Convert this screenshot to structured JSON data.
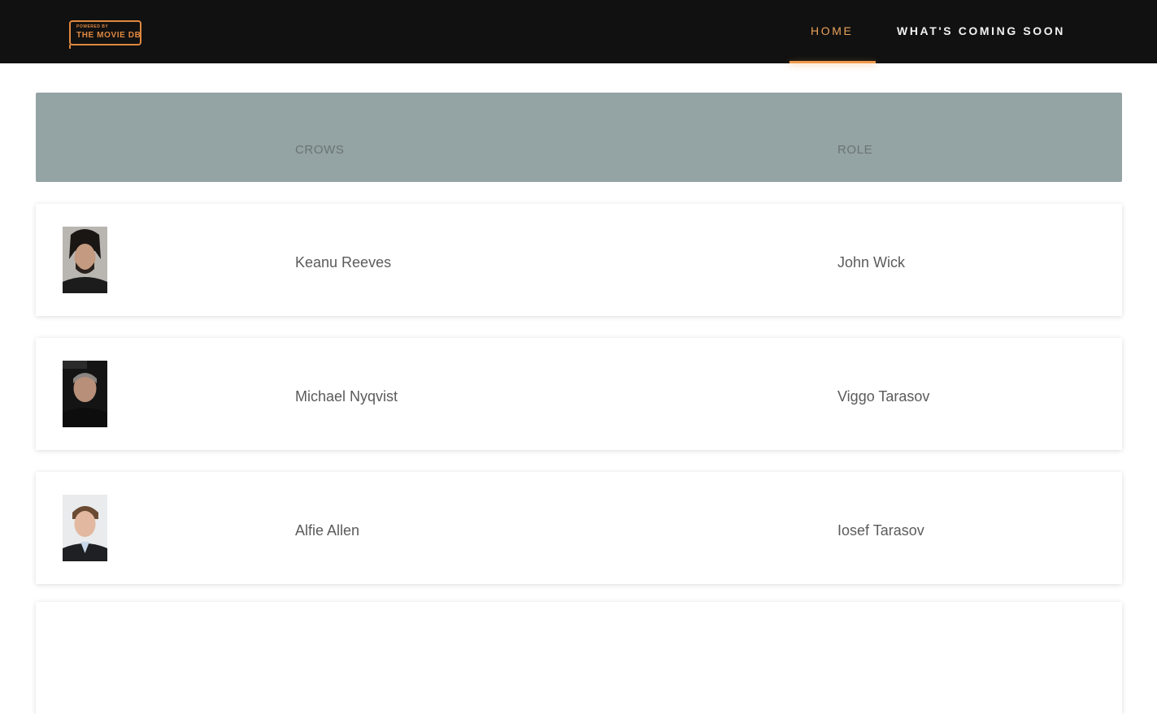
{
  "logo": {
    "small_text": "POWERED BY",
    "big_text": "THE MOVIE DB",
    "color": "#e0883f"
  },
  "nav": {
    "items": [
      {
        "label": "HOME",
        "active": true
      },
      {
        "label": "WHAT'S COMING SOON",
        "active": false
      }
    ],
    "active_color": "#e9a25c",
    "background": "#111111"
  },
  "table": {
    "header_background": "#94a3a3",
    "columns": [
      "CROWS",
      "ROLE"
    ],
    "rows": [
      {
        "name": "Keanu Reeves",
        "role": "John Wick",
        "avatar": "portrait-photo"
      },
      {
        "name": "Michael Nyqvist",
        "role": "Viggo Tarasov",
        "avatar": "portrait-photo"
      },
      {
        "name": "Alfie Allen",
        "role": "Iosef Tarasov",
        "avatar": "portrait-photo"
      }
    ]
  }
}
